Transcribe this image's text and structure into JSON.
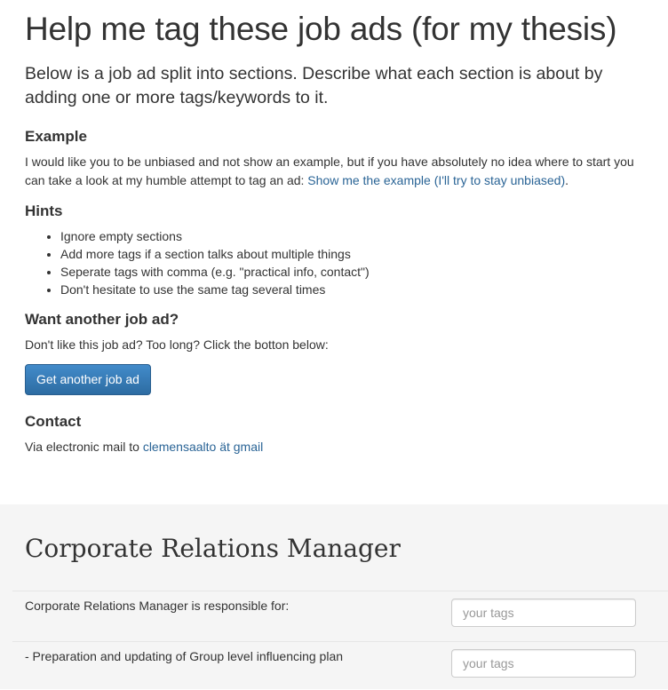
{
  "header": {
    "title": "Help me tag these job ads (for my thesis)",
    "lead": "Below is a job ad split into sections. Describe what each section is about by adding one or more tags/keywords to it."
  },
  "example": {
    "heading": "Example",
    "text": "I would like you to be unbiased and not show an example, but if you have absolutely no idea where to start you can take a look at my humble attempt to tag an ad: ",
    "link": "Show me the example (I'll try to stay unbiased)",
    "trailing": "."
  },
  "hints": {
    "heading": "Hints",
    "items": [
      "Ignore empty sections",
      "Add more tags if a section talks about multiple things",
      "Seperate tags with comma (e.g. \"practical info, contact\")",
      "Don't hesitate to use the same tag several times"
    ]
  },
  "another": {
    "heading": "Want another job ad?",
    "text": "Don't like this job ad? Too long? Click the botton below:",
    "button": "Get another job ad"
  },
  "contact": {
    "heading": "Contact",
    "text": "Via electronic mail to ",
    "link": "clemensaalto ät gmail"
  },
  "job": {
    "title": "Corporate Relations Manager",
    "sections": [
      {
        "text": "Corporate Relations Manager is responsible for:",
        "value": "",
        "placeholder": "your tags"
      },
      {
        "text": "- Preparation and updating of Group level influencing plan",
        "value": "",
        "placeholder": "your tags"
      }
    ]
  },
  "colors": {
    "link": "#2a6496",
    "button": "#2d6ca2",
    "job_background": "#f5f5f5"
  }
}
